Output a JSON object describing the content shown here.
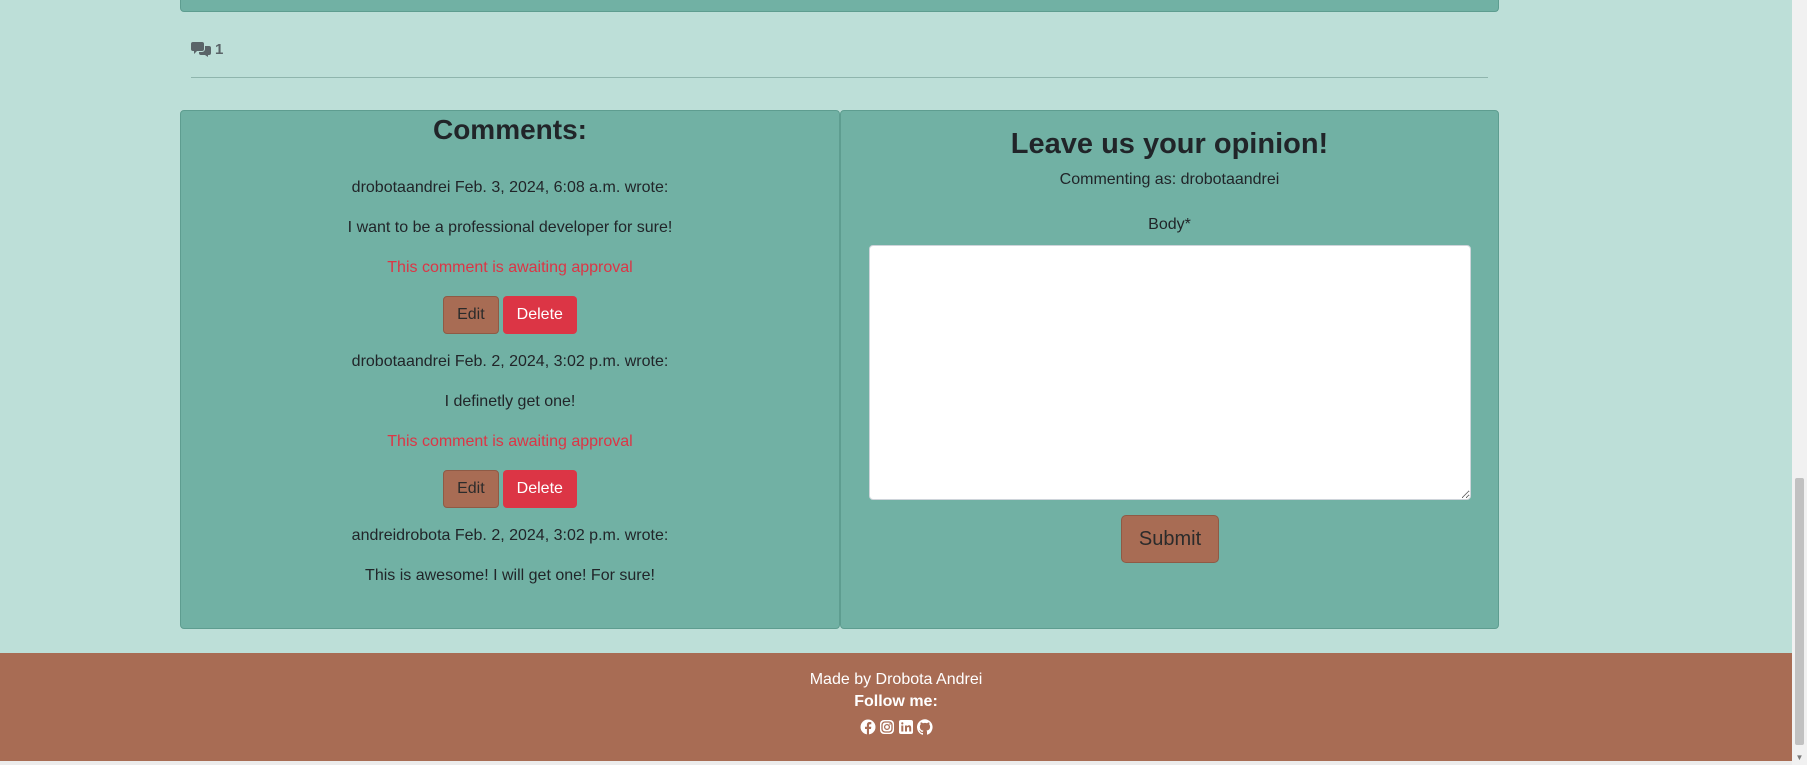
{
  "post": {
    "comment_count": "1"
  },
  "comments_panel": {
    "title": "Comments:",
    "comments": [
      {
        "meta": "drobotaandrei Feb. 3, 2024, 6:08 a.m. wrote:",
        "body": "I want to be a professional developer for sure!",
        "status": "This comment is awaiting approval",
        "edit_label": "Edit",
        "delete_label": "Delete"
      },
      {
        "meta": "drobotaandrei Feb. 2, 2024, 3:02 p.m. wrote:",
        "body": "I definetly get one!",
        "status": "This comment is awaiting approval",
        "edit_label": "Edit",
        "delete_label": "Delete"
      },
      {
        "meta": "andreidrobota Feb. 2, 2024, 3:02 p.m. wrote:",
        "body": "This is awesome! I will get one! For sure!"
      }
    ]
  },
  "form": {
    "title": "Leave us your opinion!",
    "commenting_as": "Commenting as: drobotaandrei",
    "body_label": "Body*",
    "body_value": "",
    "submit_label": "Submit"
  },
  "footer": {
    "made_by": "Made by Drobota Andrei",
    "follow": "Follow me:",
    "social_icons": [
      "facebook-icon",
      "instagram-icon",
      "linkedin-icon",
      "github-icon"
    ]
  },
  "colors": {
    "page_background": "#bddfd8",
    "card_background": "#71b1a4",
    "accent_brown": "#a86c54",
    "danger": "#dc3545"
  }
}
